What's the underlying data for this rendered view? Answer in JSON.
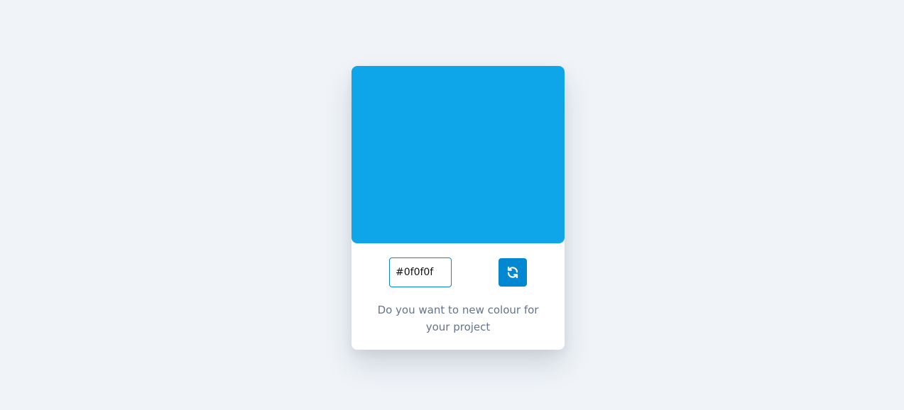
{
  "theme": {
    "background": "#f0f4f8",
    "swatch_color": "#0ea5e9",
    "button_color": "#0288d1",
    "caption_color": "#64748b"
  },
  "picker": {
    "hex_value": "#0f0f0f",
    "refresh_icon": "refresh-icon",
    "caption": "Do you want to new colour for your project"
  }
}
